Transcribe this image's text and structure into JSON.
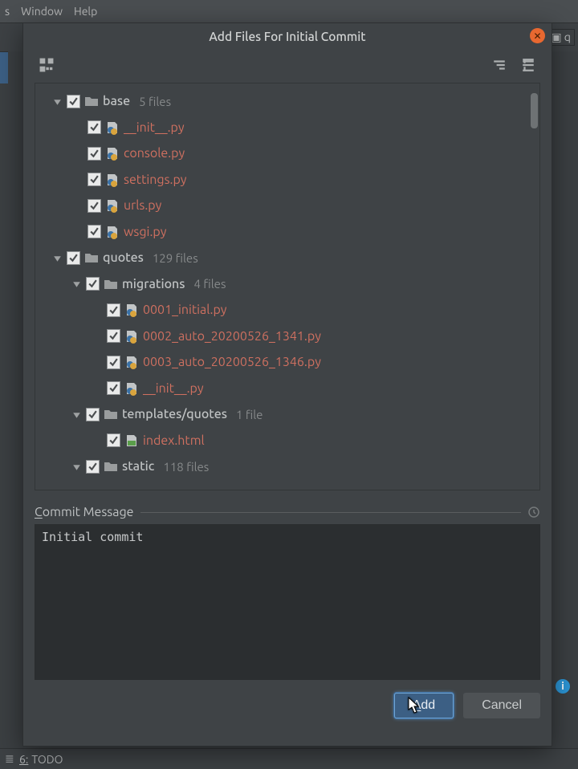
{
  "menubar": {
    "item1": "s",
    "item2": "Window",
    "item3": "Help"
  },
  "background_tab": {
    "label": "q"
  },
  "footer": {
    "todo_marker": "6:",
    "todo_label": "TODO"
  },
  "dialog": {
    "title": "Add Files For Initial Commit",
    "commit_label_prefix": "C",
    "commit_label_rest": "ommit Message",
    "commit_text": "Initial commit",
    "add_button_prefix": "A",
    "add_button_rest": "dd",
    "cancel_button": "Cancel"
  },
  "tree": [
    {
      "depth": 1,
      "expander": true,
      "type": "folder",
      "name": "base",
      "count": "5 files",
      "nameStyle": "neutral"
    },
    {
      "depth": 2,
      "expander": false,
      "type": "py",
      "name": "__init__.py"
    },
    {
      "depth": 2,
      "expander": false,
      "type": "py",
      "name": "console.py"
    },
    {
      "depth": 2,
      "expander": false,
      "type": "py",
      "name": "settings.py"
    },
    {
      "depth": 2,
      "expander": false,
      "type": "py",
      "name": "urls.py"
    },
    {
      "depth": 2,
      "expander": false,
      "type": "py",
      "name": "wsgi.py"
    },
    {
      "depth": 1,
      "expander": true,
      "type": "folder",
      "name": "quotes",
      "count": "129 files",
      "nameStyle": "neutral"
    },
    {
      "depth": 2,
      "expander": true,
      "type": "folder",
      "name": "migrations",
      "count": "4 files",
      "nameStyle": "neutral"
    },
    {
      "depth": 3,
      "expander": false,
      "type": "py",
      "name": "0001_initial.py"
    },
    {
      "depth": 3,
      "expander": false,
      "type": "py",
      "name": "0002_auto_20200526_1341.py"
    },
    {
      "depth": 3,
      "expander": false,
      "type": "py",
      "name": "0003_auto_20200526_1346.py"
    },
    {
      "depth": 3,
      "expander": false,
      "type": "py",
      "name": "__init__.py"
    },
    {
      "depth": 2,
      "expander": true,
      "type": "folder",
      "name": "templates/quotes",
      "count": "1 file",
      "nameStyle": "neutral"
    },
    {
      "depth": 3,
      "expander": false,
      "type": "html",
      "name": "index.html"
    },
    {
      "depth": 2,
      "expander": true,
      "type": "folder",
      "name": "static",
      "count": "118 files",
      "nameStyle": "neutral"
    }
  ]
}
